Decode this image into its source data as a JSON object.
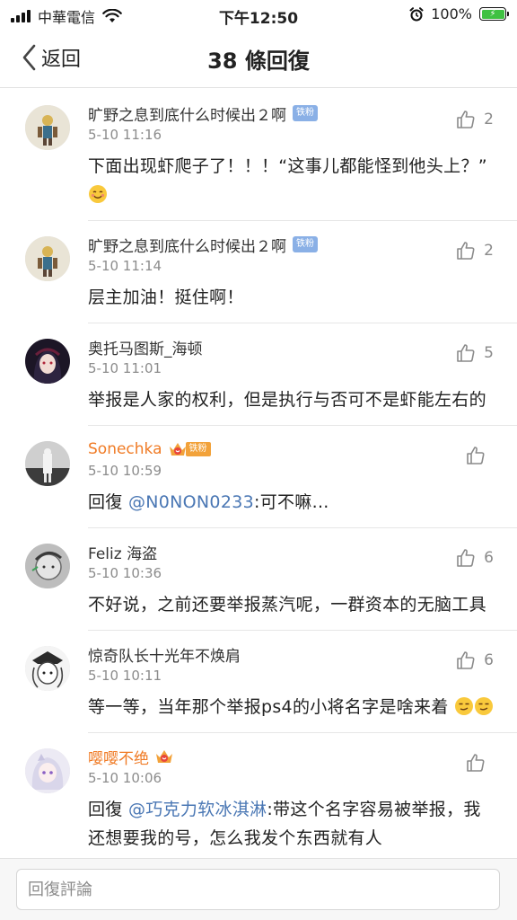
{
  "status_bar": {
    "carrier": "中華電信",
    "time": "下午12:50",
    "battery": "100%",
    "icons": [
      "signal-icon",
      "wifi-icon",
      "alarm-icon",
      "battery-icon"
    ]
  },
  "nav": {
    "back_label": "返回",
    "title": "38 條回復"
  },
  "comments": [
    {
      "user": "旷野之息到底什么时候出２啊",
      "badge": "铁粉",
      "time": "5-10 11:16",
      "likes": "2",
      "text": "下面出现虾爬子了！！！“这事儿都能怪到他头上？”"
    },
    {
      "user": "旷野之息到底什么时候出２啊",
      "badge": "铁粉",
      "time": "5-10 11:14",
      "likes": "2",
      "text": "层主加油！挺住啊！"
    },
    {
      "user": "奥托马图斯_海顿",
      "time": "5-10 11:01",
      "likes": "5",
      "text": "举报是人家的权利，但是执行与否可不是虾能左右的"
    },
    {
      "user": "Sonechka",
      "badge": "铁粉",
      "time": "5-10 10:59",
      "likes": "",
      "reply_prefix": "回復",
      "mention": "@N0NON0233",
      "text": ":可不嘛..."
    },
    {
      "user": "Feliz 海盗",
      "time": "5-10 10:36",
      "likes": "6",
      "text": "不好说，之前还要举报蒸汽呢，一群资本的无脑工具"
    },
    {
      "user": "惊奇队长十光年不焕肩",
      "time": "5-10 10:11",
      "likes": "6",
      "text": "等一等，当年那个举报ps4的小将名字是啥来着"
    },
    {
      "user": "嘤嘤不绝",
      "time": "5-10 10:06",
      "likes": "",
      "reply_prefix": "回復",
      "mention": "@巧克力软冰淇淋",
      "text": ":带这个名字容易被举报，我还想要我的号，怎么我发个东西就有人"
    }
  ],
  "input": {
    "placeholder": "回復評論"
  },
  "colors": {
    "accent_link": "#4a77b4",
    "vip_name": "#f07b25",
    "badge_bg": "#8ab0e6",
    "battery": "#3fc142"
  }
}
